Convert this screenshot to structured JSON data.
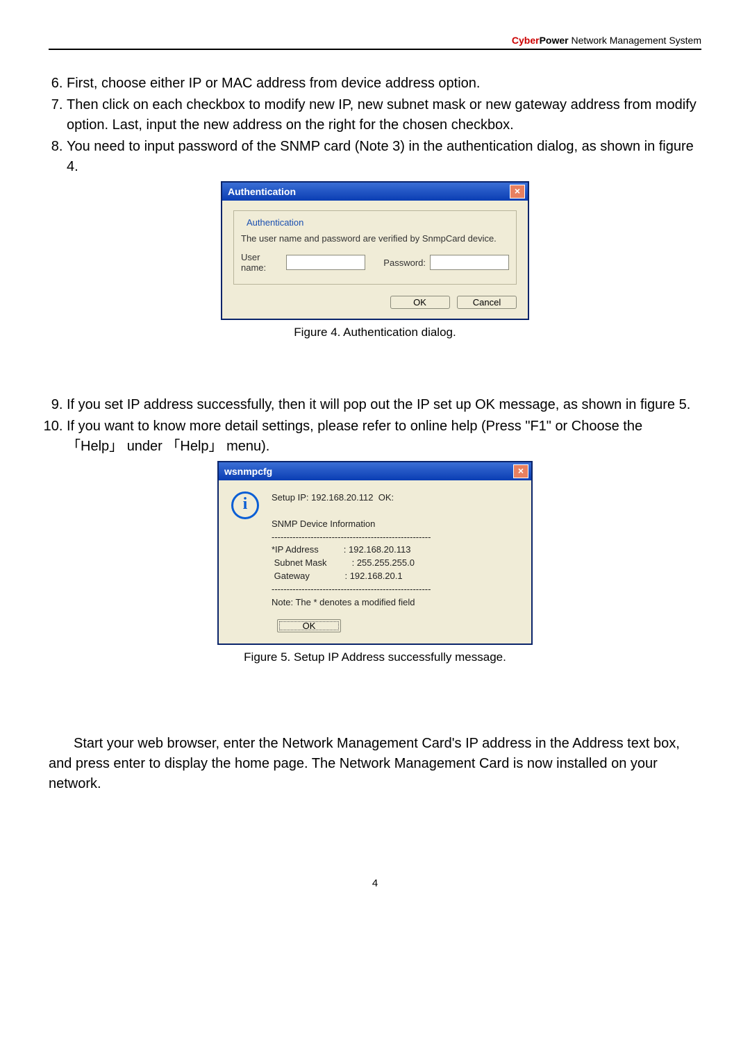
{
  "header": {
    "brand_cyber": "Cyber",
    "brand_power": "Power",
    "brand_suffix": " Network Management System"
  },
  "steps_a": {
    "s6": "First, choose either IP or MAC address from device address option.",
    "s7": "Then click on each checkbox to modify new IP, new subnet mask or new gateway address from modify option. Last, input the new address on the right for the chosen checkbox.",
    "s8": "You need to input password of the SNMP card (Note 3) in the authentication dialog, as shown in figure 4."
  },
  "auth_dialog": {
    "title": "Authentication",
    "close": "×",
    "legend": "Authentication",
    "desc": "The user name and password are verified by SnmpCard device.",
    "user_label": "User name:",
    "pass_label": "Password:",
    "user_value": "",
    "pass_value": "",
    "ok": "OK",
    "cancel": "Cancel"
  },
  "caption4": "Figure 4. Authentication dialog.",
  "steps_b": {
    "s9": "If you set IP address successfully, then it will pop out the IP set up OK message, as shown in figure 5.",
    "s10": "If you want to know more detail settings, please refer to online help (Press \"F1\" or Choose the 「Help」 under 「Help」 menu)."
  },
  "ws_dialog": {
    "title": "wsnmpcfg",
    "close": "×",
    "info_glyph": "i",
    "line1": "Setup IP: 192.168.20.112  OK:",
    "line2": "SNMP Device Information",
    "sep": "-----------------------------------------------------",
    "row_ip": "*IP Address          : 192.168.20.113",
    "row_mask": " Subnet Mask          : 255.255.255.0",
    "row_gw": " Gateway              : 192.168.20.1",
    "note": "Note: The * denotes a modified field",
    "ok": "OK"
  },
  "caption5": "Figure 5. Setup IP Address successfully message.",
  "bottom_para": "Start your web browser, enter the Network Management Card's IP address in the Address text box, and press enter to display the home page. The Network Management Card is now installed on your network.",
  "page_number": "4"
}
